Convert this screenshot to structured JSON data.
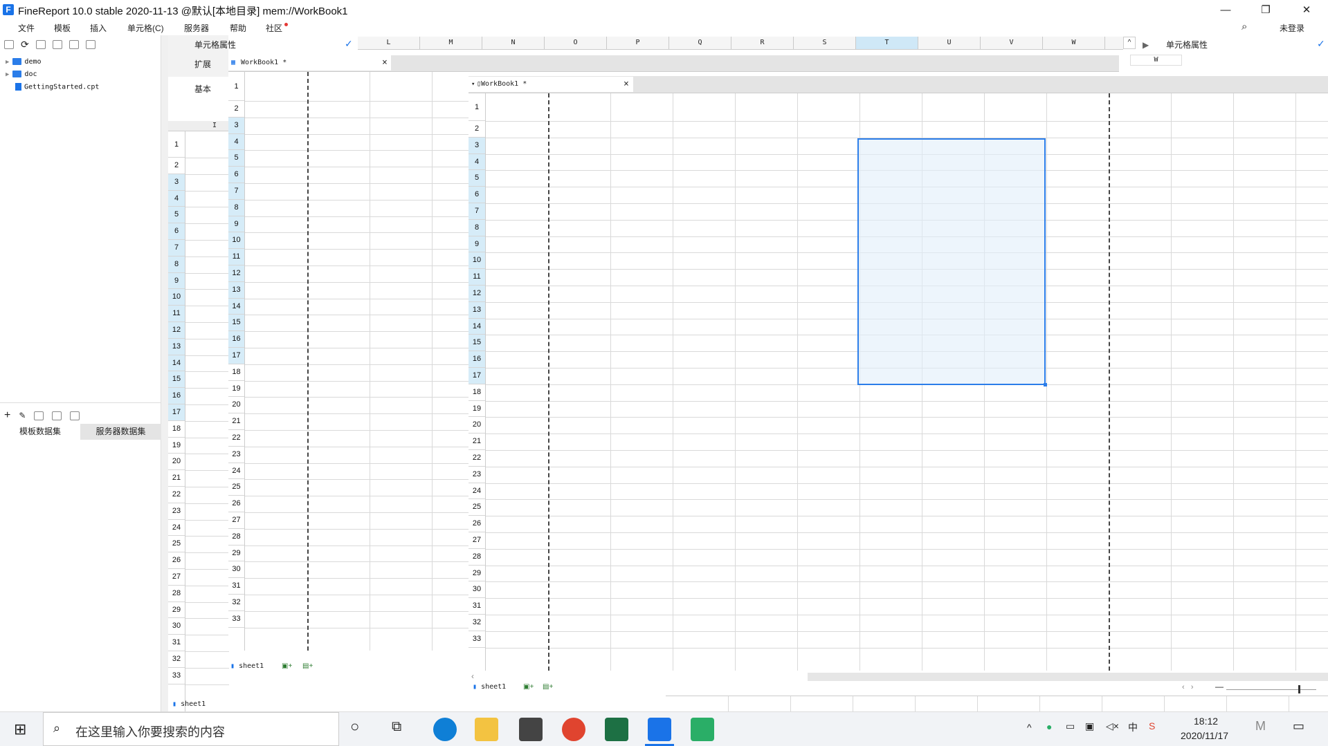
{
  "window": {
    "title": "FineReport 10.0 stable 2020-11-13 @默认[本地目录]    mem://WorkBook1",
    "logo_letter": "F"
  },
  "window_controls": {
    "minimize": "—",
    "restore": "❐",
    "close": "✕"
  },
  "menu": {
    "items": [
      "文件",
      "模板",
      "插入",
      "单元格(C)",
      "服务器",
      "帮助",
      "社区"
    ],
    "login": "未登录"
  },
  "tree": {
    "items": [
      {
        "type": "folder",
        "label": "demo"
      },
      {
        "type": "folder",
        "label": "doc"
      },
      {
        "type": "file",
        "label": "GettingStarted.cpt"
      }
    ]
  },
  "datasets": {
    "tabs": [
      "模板数据集",
      "服务器数据集"
    ]
  },
  "cell_property": {
    "label": "单元格属性",
    "label_right": "单元格属性",
    "expand_tab": "扩展",
    "basic_tab": "基本",
    "col_i": "I",
    "col_w": "W"
  },
  "columns_top": [
    "L",
    "M",
    "N",
    "O",
    "P",
    "Q",
    "R",
    "S",
    "T",
    "U",
    "V",
    "W"
  ],
  "tabs": {
    "doc1": "WorkBook1 *",
    "doc2": "WorkBook1 *",
    "close": "×"
  },
  "sheets": {
    "sheet1": "sheet1"
  },
  "rows_left": [
    "1",
    "2",
    "3",
    "4",
    "5",
    "6",
    "7",
    "8",
    "9",
    "10",
    "11",
    "12",
    "13",
    "14",
    "15",
    "16",
    "17",
    "18",
    "19",
    "20",
    "21",
    "22",
    "23",
    "24",
    "25",
    "26",
    "27",
    "28",
    "29",
    "30",
    "31",
    "32",
    "33"
  ],
  "rows_mid": [
    "1",
    "2",
    "3",
    "4",
    "5",
    "6",
    "7",
    "8",
    "9",
    "10",
    "11",
    "12",
    "13",
    "14",
    "15",
    "16",
    "17",
    "18",
    "19",
    "20",
    "21",
    "22",
    "23",
    "24",
    "25",
    "26",
    "27",
    "28",
    "29",
    "30",
    "31",
    "32",
    "33"
  ],
  "rows_main": [
    "1",
    "2",
    "3",
    "4",
    "5",
    "6",
    "7",
    "8",
    "9",
    "10",
    "11",
    "12",
    "13",
    "14",
    "15",
    "16",
    "17",
    "18",
    "19",
    "20",
    "21",
    "22",
    "23",
    "24",
    "25",
    "26",
    "27",
    "28",
    "29",
    "30",
    "31",
    "32",
    "33"
  ],
  "taskbar": {
    "search_placeholder": "在这里输入你要搜索的内容",
    "time": "18:12",
    "date": "2020/11/17"
  },
  "colors": {
    "accent": "#2b7de9",
    "selection_fill": "#eaf3fc",
    "row_header_hl": "#d6ecf8",
    "col_header_hl": "#cfe8f7"
  }
}
